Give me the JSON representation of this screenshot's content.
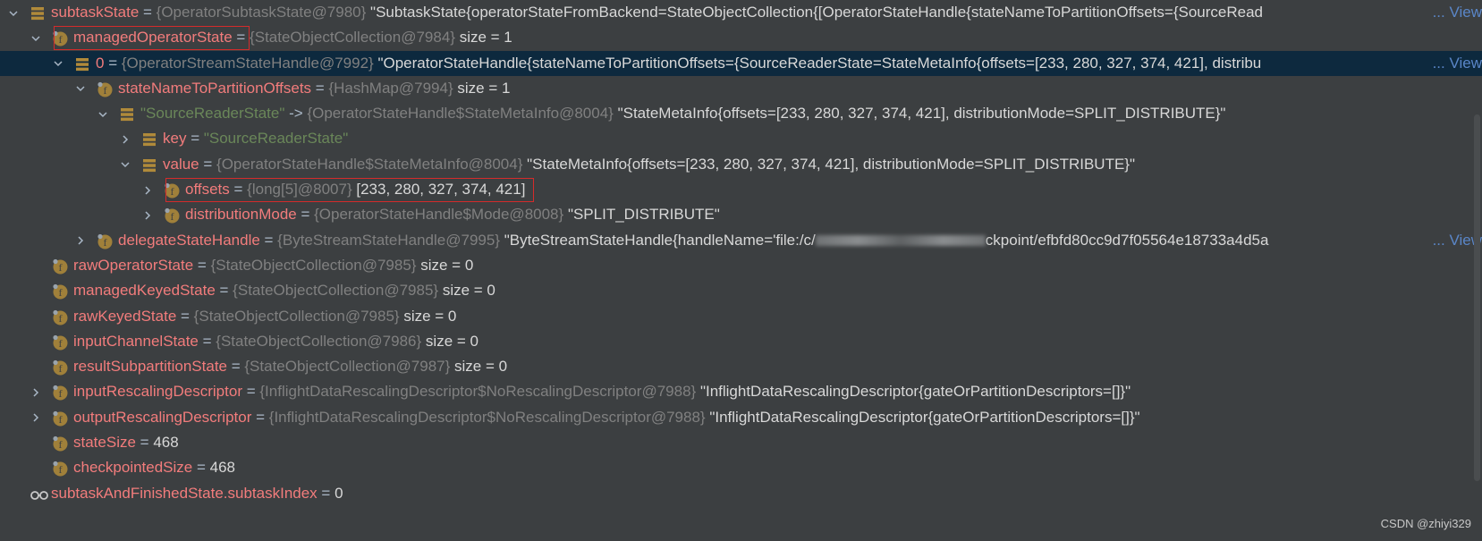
{
  "rows": [
    {
      "level": 0,
      "arrow": "down",
      "icon": "list",
      "name": "subtaskState",
      "type": "{OperatorSubtaskState@7980}",
      "value": "\"SubtaskState{operatorStateFromBackend=StateObjectCollection{[OperatorStateHandle{stateNameToPartitionOffsets={SourceRead",
      "view": "... View"
    },
    {
      "level": 1,
      "arrow": "down",
      "icon": "field",
      "name": "managedOperatorState",
      "type": "{StateObjectCollection@7984}",
      "value": "size = 1"
    },
    {
      "level": 2,
      "arrow": "down",
      "icon": "list",
      "name": "0",
      "type": "{OperatorStreamStateHandle@7992}",
      "value": "\"OperatorStateHandle{stateNameToPartitionOffsets={SourceReaderState=StateMetaInfo{offsets=[233, 280, 327, 374, 421], distribu",
      "view": "... View",
      "selected": true
    },
    {
      "level": 3,
      "arrow": "down",
      "icon": "field",
      "name": "stateNameToPartitionOffsets",
      "type": "{HashMap@7994}",
      "value": "size = 1"
    },
    {
      "level": 4,
      "arrow": "down",
      "icon": "list",
      "name": "\"SourceReaderState\"",
      "name_string": true,
      "eq": "->",
      "type": "{OperatorStateHandle$StateMetaInfo@8004}",
      "value": "\"StateMetaInfo{offsets=[233, 280, 327, 374, 421], distributionMode=SPLIT_DISTRIBUTE}\""
    },
    {
      "level": 5,
      "arrow": "right",
      "icon": "list",
      "name": "key",
      "type": "",
      "value": "\"SourceReaderState\"",
      "value_string": true
    },
    {
      "level": 5,
      "arrow": "down",
      "icon": "list",
      "name": "value",
      "type": "{OperatorStateHandle$StateMetaInfo@8004}",
      "value": "\"StateMetaInfo{offsets=[233, 280, 327, 374, 421], distributionMode=SPLIT_DISTRIBUTE}\""
    },
    {
      "level": 6,
      "arrow": "right",
      "icon": "field",
      "name": "offsets",
      "type": "{long[5]@8007}",
      "value": "[233, 280, 327, 374, 421]"
    },
    {
      "level": 6,
      "arrow": "right",
      "icon": "field",
      "name": "distributionMode",
      "type": "{OperatorStateHandle$Mode@8008}",
      "value": "\"SPLIT_DISTRIBUTE\""
    },
    {
      "level": 3,
      "arrow": "right",
      "icon": "field",
      "name": "delegateStateHandle",
      "type": "{ByteStreamStateHandle@7995}",
      "value": "\"ByteStreamStateHandle{handleName='file:/c/",
      "blurred": true,
      "value_after": "ckpoint/efbfd80cc9d7f05564e18733a4d5a",
      "view": "... View"
    },
    {
      "level": 1,
      "arrow": null,
      "icon": "field",
      "name": "rawOperatorState",
      "type": "{StateObjectCollection@7985}",
      "value": "size = 0"
    },
    {
      "level": 1,
      "arrow": null,
      "icon": "field",
      "name": "managedKeyedState",
      "type": "{StateObjectCollection@7985}",
      "value": "size = 0"
    },
    {
      "level": 1,
      "arrow": null,
      "icon": "field",
      "name": "rawKeyedState",
      "type": "{StateObjectCollection@7985}",
      "value": "size = 0"
    },
    {
      "level": 1,
      "arrow": null,
      "icon": "field",
      "name": "inputChannelState",
      "type": "{StateObjectCollection@7986}",
      "value": "size = 0"
    },
    {
      "level": 1,
      "arrow": null,
      "icon": "field",
      "name": "resultSubpartitionState",
      "type": "{StateObjectCollection@7987}",
      "value": "size = 0"
    },
    {
      "level": 1,
      "arrow": "right",
      "icon": "field",
      "name": "inputRescalingDescriptor",
      "type": "{InflightDataRescalingDescriptor$NoRescalingDescriptor@7988}",
      "value": "\"InflightDataRescalingDescriptor{gateOrPartitionDescriptors=[]}\""
    },
    {
      "level": 1,
      "arrow": "right",
      "icon": "field",
      "name": "outputRescalingDescriptor",
      "type": "{InflightDataRescalingDescriptor$NoRescalingDescriptor@7988}",
      "value": "\"InflightDataRescalingDescriptor{gateOrPartitionDescriptors=[]}\""
    },
    {
      "level": 1,
      "arrow": null,
      "icon": "field",
      "name": "stateSize",
      "type": "",
      "value": "468"
    },
    {
      "level": 1,
      "arrow": null,
      "icon": "field",
      "name": "checkpointedSize",
      "type": "",
      "value": "468"
    },
    {
      "level": 0,
      "arrow": null,
      "icon": "watch",
      "name": "subtaskAndFinishedState.subtaskIndex",
      "type": "",
      "value": "0"
    }
  ],
  "watermark": "CSDN @zhiyi329",
  "colors": {
    "background": "#3c3f41",
    "selected_row": "#0d293e",
    "field_name": "#f27c7c",
    "string": "#6a8759",
    "type": "#808080",
    "link": "#5a86c8",
    "highlight_box": "#d42b2b"
  }
}
